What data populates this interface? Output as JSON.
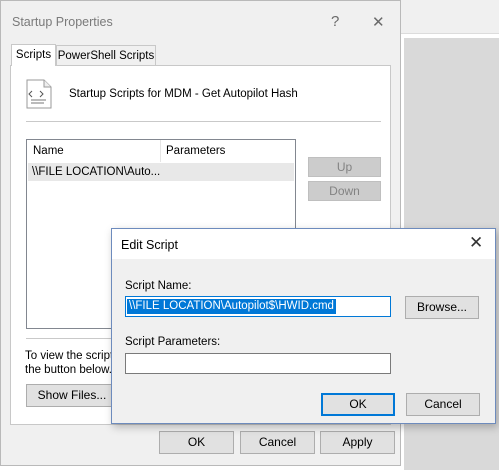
{
  "startup_dialog": {
    "title": "Startup Properties",
    "help_glyph": "?",
    "close_glyph": "✕",
    "tabs": [
      {
        "label": "Scripts",
        "active": true
      },
      {
        "label": "PowerShell Scripts",
        "active": false
      }
    ],
    "description": "Startup Scripts for MDM - Get Autopilot Hash",
    "list": {
      "columns": [
        "Name",
        "Parameters"
      ],
      "rows": [
        {
          "name": "\\\\FILE LOCATION\\Auto...",
          "parameters": ""
        }
      ]
    },
    "side_buttons": {
      "up": "Up",
      "down": "Down"
    },
    "info_line1": "To view the script f",
    "info_line2": "the button below.",
    "show_files": "Show Files...",
    "footer": {
      "ok": "OK",
      "cancel": "Cancel",
      "apply": "Apply"
    }
  },
  "edit_script": {
    "title": "Edit Script",
    "close_glyph": "✕",
    "script_name_label": "Script Name:",
    "script_name_value": "\\\\FILE LOCATION\\Autopilot$\\HWID.cmd",
    "browse": "Browse...",
    "script_params_label": "Script Parameters:",
    "script_params_value": "",
    "ok": "OK",
    "cancel": "Cancel"
  },
  "colors": {
    "accent": "#0078d7",
    "dialog_bg": "#f0f0f0",
    "selection_row": "#e8e8e8",
    "disabled_button": "#cccccc"
  }
}
